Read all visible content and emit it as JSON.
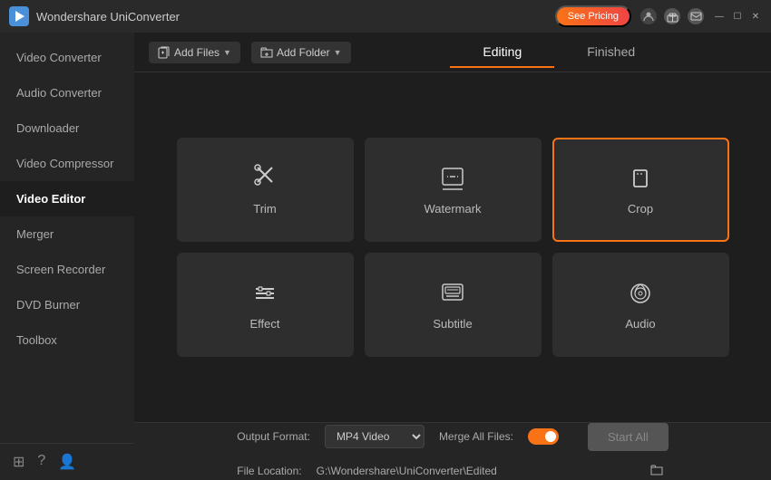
{
  "titlebar": {
    "logo_alt": "Wondershare UniConverter logo",
    "title": "Wondershare UniConverter",
    "pricing_label": "See Pricing",
    "win_controls": [
      "—",
      "☐",
      "✕"
    ]
  },
  "sidebar": {
    "items": [
      {
        "id": "video-converter",
        "label": "Video Converter"
      },
      {
        "id": "audio-converter",
        "label": "Audio Converter"
      },
      {
        "id": "downloader",
        "label": "Downloader"
      },
      {
        "id": "video-compressor",
        "label": "Video Compressor"
      },
      {
        "id": "video-editor",
        "label": "Video Editor",
        "active": true
      },
      {
        "id": "merger",
        "label": "Merger"
      },
      {
        "id": "screen-recorder",
        "label": "Screen Recorder"
      },
      {
        "id": "dvd-burner",
        "label": "DVD Burner"
      },
      {
        "id": "toolbox",
        "label": "Toolbox"
      }
    ]
  },
  "toolbar": {
    "add_files_label": "Add Files",
    "add_folder_label": "Add Folder"
  },
  "tabs": {
    "editing": "Editing",
    "finished": "Finished"
  },
  "grid": {
    "cards": [
      {
        "id": "trim",
        "label": "Trim",
        "icon": "trim"
      },
      {
        "id": "watermark",
        "label": "Watermark",
        "icon": "watermark"
      },
      {
        "id": "crop",
        "label": "Crop",
        "icon": "crop",
        "selected": true
      },
      {
        "id": "effect",
        "label": "Effect",
        "icon": "effect"
      },
      {
        "id": "subtitle",
        "label": "Subtitle",
        "icon": "subtitle"
      },
      {
        "id": "audio",
        "label": "Audio",
        "icon": "audio"
      }
    ]
  },
  "bottom": {
    "output_format_label": "Output Format:",
    "output_format_value": "MP4 Video",
    "merge_all_label": "Merge All Files:",
    "file_location_label": "File Location:",
    "file_location_path": "G:\\Wondershare\\UniConverter\\Edited",
    "start_all_label": "Start All"
  }
}
